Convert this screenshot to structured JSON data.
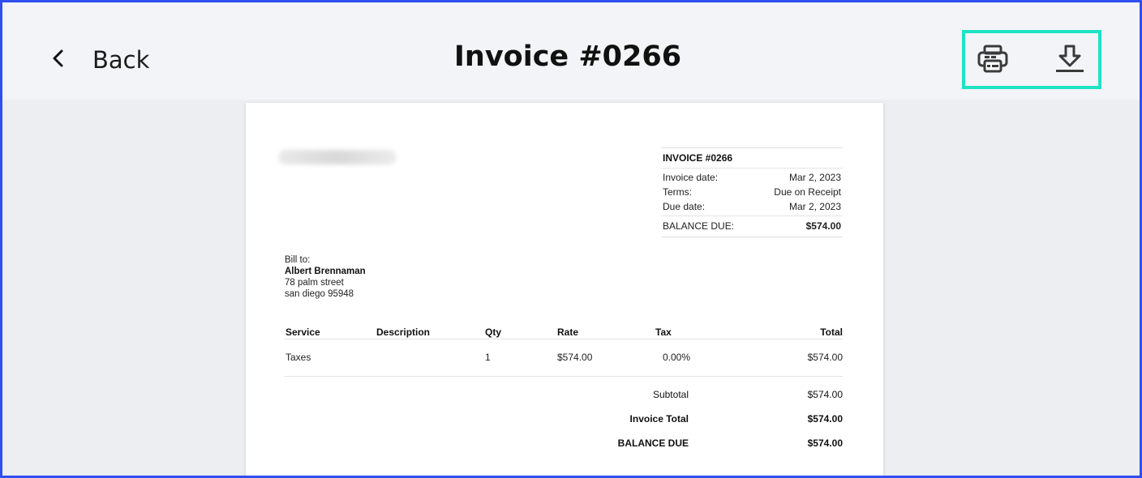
{
  "header": {
    "back_label": "Back",
    "title": "Invoice #0266",
    "print_icon": "printer-icon",
    "download_icon": "download-icon",
    "highlight_color": "#1de3c4"
  },
  "invoice": {
    "summary_title": "INVOICE #0266",
    "rows": [
      {
        "label": "Invoice date:",
        "value": "Mar 2, 2023"
      },
      {
        "label": "Terms:",
        "value": "Due on Receipt"
      },
      {
        "label": "Due date:",
        "value": "Mar 2, 2023"
      }
    ],
    "balance_label": "BALANCE DUE:",
    "balance_value": "$574.00",
    "bill_to": {
      "label": "Bill to:",
      "name": "Albert Brennaman",
      "street": "78 palm street",
      "city": "san diego 95948"
    },
    "table": {
      "columns": [
        "Service",
        "Description",
        "Qty",
        "Rate",
        "Tax",
        "Total"
      ],
      "rows": [
        [
          "Taxes",
          "",
          "1",
          "$574.00",
          "0.00%",
          "$574.00"
        ]
      ]
    },
    "totals": [
      {
        "label": "Subtotal",
        "value": "$574.00"
      },
      {
        "label": "Invoice Total",
        "value": "$574.00"
      },
      {
        "label": "BALANCE DUE",
        "value": "$574.00"
      }
    ]
  }
}
